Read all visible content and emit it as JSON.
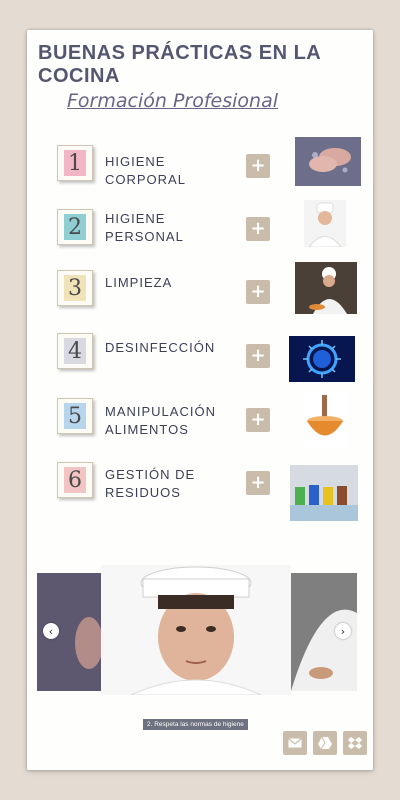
{
  "header": {
    "title": "BUENAS PRÁCTICAS EN LA COCINA",
    "subtitle": "Formación Profesional"
  },
  "items": [
    {
      "number": "1",
      "label": "HIGIENE CORPORAL",
      "tile_color": "#f3b6c7",
      "action": "+"
    },
    {
      "number": "2",
      "label": "HIGIENE PERSONAL",
      "tile_color": "#8fcfd3",
      "action": "+"
    },
    {
      "number": "3",
      "label": "LIMPIEZA",
      "tile_color": "#f1e3b8",
      "action": "+"
    },
    {
      "number": "4",
      "label": "DESINFECCIÓN",
      "tile_color": "#d9d9e1",
      "action": "+"
    },
    {
      "number": "5",
      "label": "MANIPULACIÓN ALIMENTOS",
      "tile_color": "#b7d6ee",
      "action": "+"
    },
    {
      "number": "6",
      "label": "GESTIÓN DE RESIDUOS",
      "tile_color": "#f3c4c4",
      "action": "+"
    }
  ],
  "slider": {
    "caption": "2. Respeta las normas de higiene",
    "prev_icon": "‹",
    "next_icon": "›"
  },
  "share": [
    "mail-icon",
    "drive-icon",
    "dropbox-icon"
  ],
  "colors": {
    "background": "#e4dcd3",
    "accent": "#c9bcaa",
    "title": "#555770",
    "subtitle": "#6a6488"
  }
}
